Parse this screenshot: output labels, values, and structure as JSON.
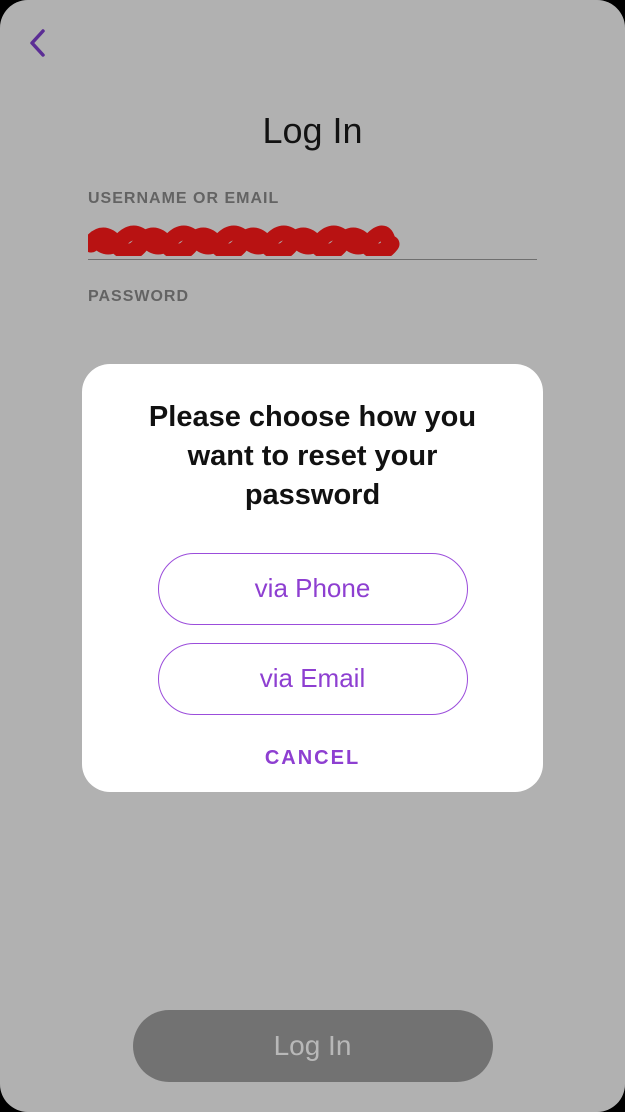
{
  "header": {
    "title": "Log In"
  },
  "form": {
    "username_label": "USERNAME OR EMAIL",
    "password_label": "PASSWORD"
  },
  "login_button": {
    "label": "Log In"
  },
  "modal": {
    "title": "Please choose how you want to reset your password",
    "via_phone": "via Phone",
    "via_email": "via Email",
    "cancel": "CANCEL"
  },
  "colors": {
    "accent": "#8e3fd1"
  }
}
